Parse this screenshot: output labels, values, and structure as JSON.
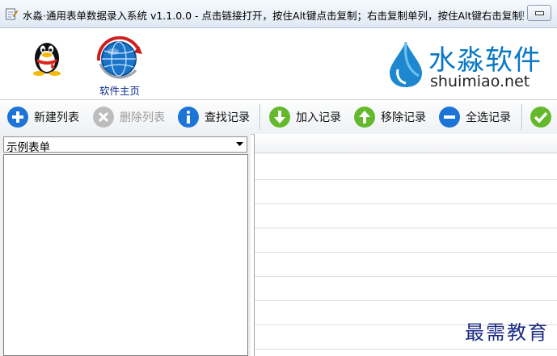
{
  "window": {
    "title": "水淼·通用表单数据录入系统 v1.1.0.0 - 点击链接打开，按住Alt键点击复制；右击复制单列，按住Alt键右击复制整..."
  },
  "banner": {
    "home_label": "软件主页",
    "logo_name": "水淼软件",
    "logo_domain": "shuimiao.net",
    "icons": [
      "qq-penguin-icon",
      "globe-arrow-icon",
      "water-drop-logo"
    ]
  },
  "toolbar": {
    "new_list": "新建列表",
    "delete_list": "删除列表",
    "find_record": "查找记录",
    "add_record": "加入记录",
    "remove_record": "移除记录",
    "select_all": "全选记录"
  },
  "left_panel": {
    "selected_form": "示例表单"
  },
  "watermark": "最需教育",
  "colors": {
    "accent_blue": "#1b74d6",
    "action_green": "#63b92b",
    "logo_blue": "#0a78c4",
    "disabled_gray": "#b8b8b8"
  }
}
